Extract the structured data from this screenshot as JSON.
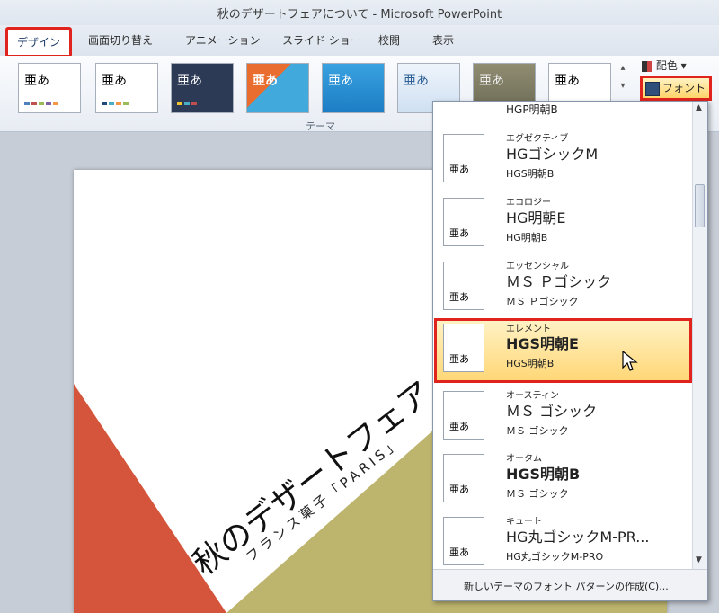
{
  "window": {
    "title": "秋のデザートフェアについて - Microsoft PowerPoint"
  },
  "tabs": [
    {
      "label": "デザイン",
      "active": true
    },
    {
      "label": "画面切り替え"
    },
    {
      "label": "アニメーション"
    },
    {
      "label": "スライド ショー"
    },
    {
      "label": "校閲"
    },
    {
      "label": "表示"
    }
  ],
  "ribbon": {
    "theme_sample": "亜あ",
    "group_label": "テーマ",
    "colors_label": "配色 ▾",
    "fonts_label": "フォント ▾"
  },
  "slide": {
    "title": "秋のデザートフェア",
    "subtitle": "フランス菓子「PARIS」"
  },
  "dropdown": {
    "thumb_text": "亜あ",
    "top_partial": "HGP明朝B",
    "items": [
      {
        "name": "エグゼクティブ",
        "head": "HGゴシックM",
        "body": "HGS明朝B"
      },
      {
        "name": "エコロジー",
        "head": "HG明朝E",
        "body": "HG明朝B"
      },
      {
        "name": "エッセンシャル",
        "head": "ＭＳ Ｐゴシック",
        "body": "ＭＳ Ｐゴシック"
      },
      {
        "name": "エレメント",
        "head": "HGS明朝E",
        "body": "HGS明朝B"
      },
      {
        "name": "オースティン",
        "head": "ＭＳ ゴシック",
        "body": "ＭＳ ゴシック"
      },
      {
        "name": "オータム",
        "head": "HGS明朝B",
        "body": "ＭＳ ゴシック"
      },
      {
        "name": "キュート",
        "head": "HG丸ゴシックM-PR...",
        "body": "HG丸ゴシックM-PRO"
      }
    ],
    "footer": "新しいテーマのフォント パターンの作成(C)..."
  },
  "colors": {
    "accent_red": "#e0231c",
    "highlight": "#ffd777",
    "slide_red": "#d4553c",
    "slide_olive": "#bdb46e"
  }
}
